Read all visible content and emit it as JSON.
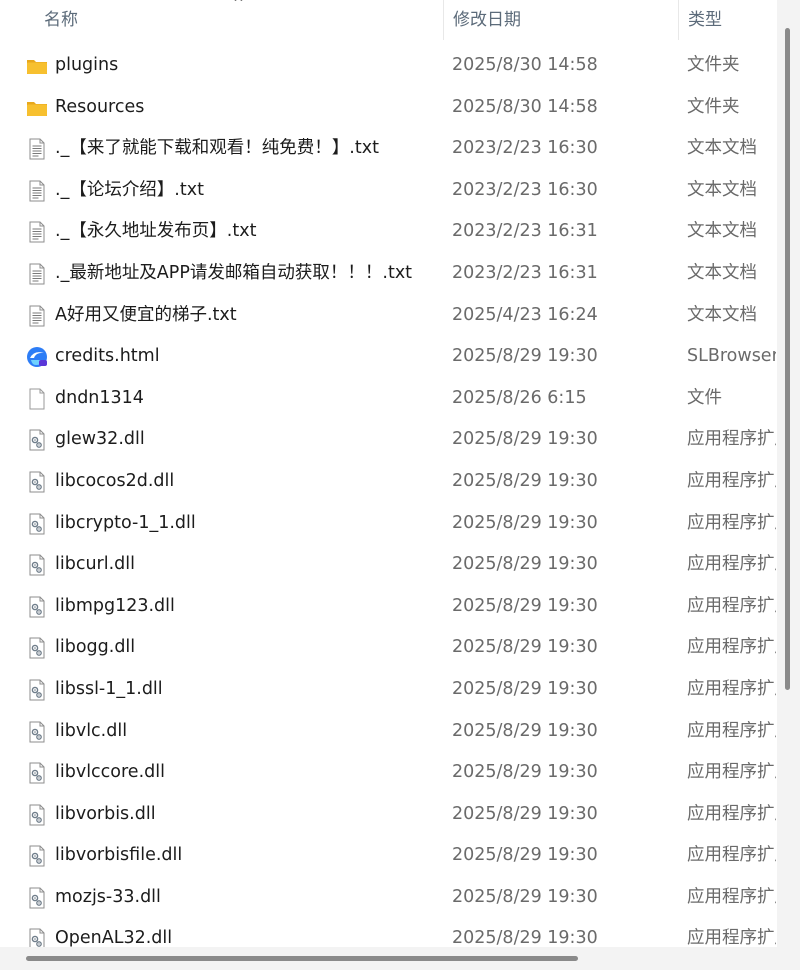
{
  "header": {
    "col_name": "名称",
    "col_date": "修改日期",
    "col_type": "类型",
    "sort_indicator": "^"
  },
  "files": [
    {
      "name": "plugins",
      "date": "2025/8/30 14:58",
      "type": "文件夹",
      "icon": "folder-icon"
    },
    {
      "name": "Resources",
      "date": "2025/8/30 14:58",
      "type": "文件夹",
      "icon": "folder-icon"
    },
    {
      "name": "._【来了就能下载和观看！纯免费！】.txt",
      "date": "2023/2/23 16:30",
      "type": "文本文档",
      "icon": "text-document-icon"
    },
    {
      "name": "._【论坛介绍】.txt",
      "date": "2023/2/23 16:30",
      "type": "文本文档",
      "icon": "text-document-icon"
    },
    {
      "name": "._【永久地址发布页】.txt",
      "date": "2023/2/23 16:31",
      "type": "文本文档",
      "icon": "text-document-icon"
    },
    {
      "name": "._最新地址及APP请发邮箱自动获取！！！.txt",
      "date": "2023/2/23 16:31",
      "type": "文本文档",
      "icon": "text-document-icon"
    },
    {
      "name": "A好用又便宜的梯子.txt",
      "date": "2025/4/23 16:24",
      "type": "文本文档",
      "icon": "text-document-icon"
    },
    {
      "name": "credits.html",
      "date": "2025/8/29 19:30",
      "type": "SLBrowser",
      "icon": "browser-icon"
    },
    {
      "name": "dndn1314",
      "date": "2025/8/26 6:15",
      "type": "文件",
      "icon": "blank-file-icon"
    },
    {
      "name": "glew32.dll",
      "date": "2025/8/29 19:30",
      "type": "应用程序扩展",
      "icon": "dll-file-icon"
    },
    {
      "name": "libcocos2d.dll",
      "date": "2025/8/29 19:30",
      "type": "应用程序扩展",
      "icon": "dll-file-icon"
    },
    {
      "name": "libcrypto-1_1.dll",
      "date": "2025/8/29 19:30",
      "type": "应用程序扩展",
      "icon": "dll-file-icon"
    },
    {
      "name": "libcurl.dll",
      "date": "2025/8/29 19:30",
      "type": "应用程序扩展",
      "icon": "dll-file-icon"
    },
    {
      "name": "libmpg123.dll",
      "date": "2025/8/29 19:30",
      "type": "应用程序扩展",
      "icon": "dll-file-icon"
    },
    {
      "name": "libogg.dll",
      "date": "2025/8/29 19:30",
      "type": "应用程序扩展",
      "icon": "dll-file-icon"
    },
    {
      "name": "libssl-1_1.dll",
      "date": "2025/8/29 19:30",
      "type": "应用程序扩展",
      "icon": "dll-file-icon"
    },
    {
      "name": "libvlc.dll",
      "date": "2025/8/29 19:30",
      "type": "应用程序扩展",
      "icon": "dll-file-icon"
    },
    {
      "name": "libvlccore.dll",
      "date": "2025/8/29 19:30",
      "type": "应用程序扩展",
      "icon": "dll-file-icon"
    },
    {
      "name": "libvorbis.dll",
      "date": "2025/8/29 19:30",
      "type": "应用程序扩展",
      "icon": "dll-file-icon"
    },
    {
      "name": "libvorbisfile.dll",
      "date": "2025/8/29 19:30",
      "type": "应用程序扩展",
      "icon": "dll-file-icon"
    },
    {
      "name": "mozjs-33.dll",
      "date": "2025/8/29 19:30",
      "type": "应用程序扩展",
      "icon": "dll-file-icon"
    },
    {
      "name": "OpenAL32.dll",
      "date": "2025/8/29 19:30",
      "type": "应用程序扩展",
      "icon": "dll-file-icon"
    }
  ],
  "colors": {
    "folder": "#f7c02f",
    "header_text": "#5c6b7a",
    "secondary_text": "#6a6a6a",
    "scrollbar_thumb": "#8a8a8a"
  }
}
